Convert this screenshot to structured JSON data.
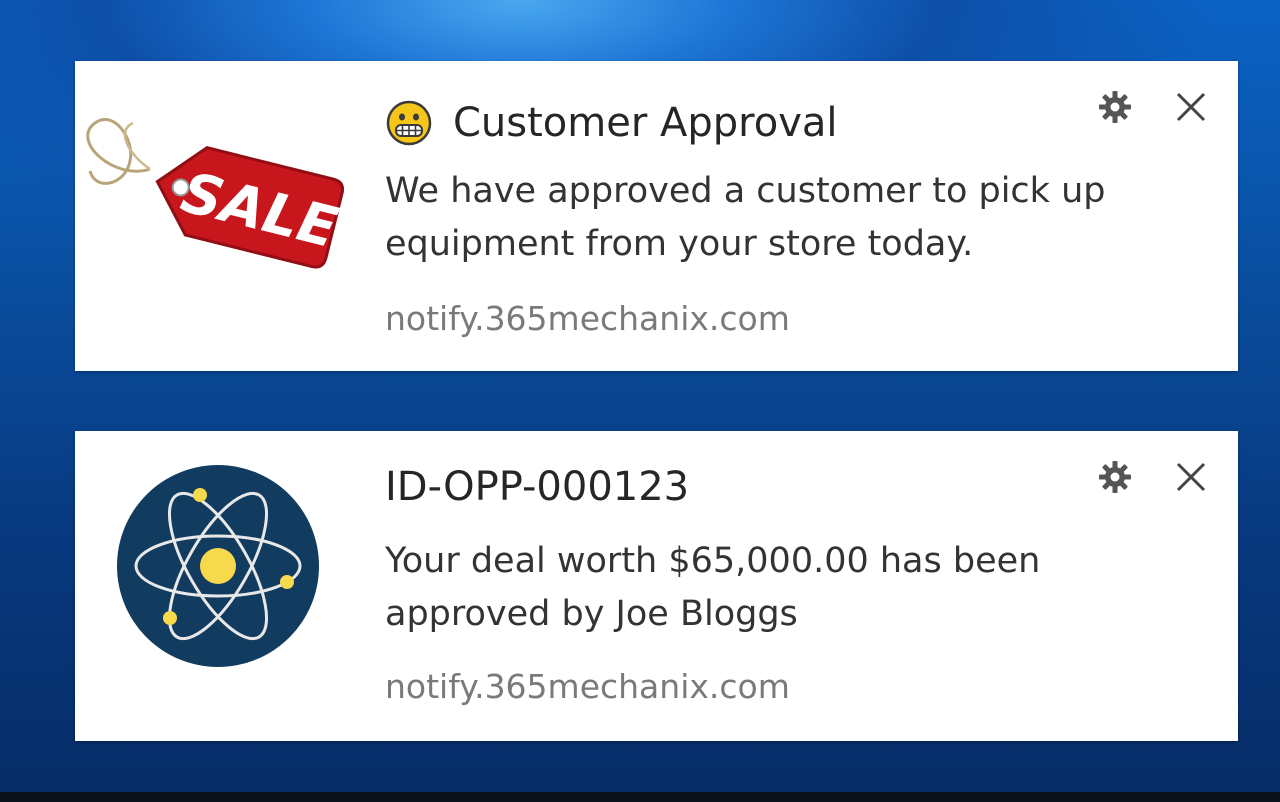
{
  "notifications": [
    {
      "image": "sale-tag-icon",
      "title_icon": "grimacing-face-emoji-icon",
      "title": "Customer Approval",
      "message": "We have approved a customer to pick up equipment from your store today.",
      "source": "notify.365mechanix.com",
      "image_text": "SALE"
    },
    {
      "image": "atom-logo-icon",
      "title": "ID-OPP-000123",
      "message": "Your deal worth $65,000.00 has been approved by Joe Bloggs",
      "source": "notify.365mechanix.com"
    }
  ],
  "colors": {
    "sale_tag_red": "#c8161d",
    "atom_circle": "#123b60",
    "atom_yellow": "#f7d94c",
    "emoji_yellow": "#f5c518",
    "desktop_blue": "#0a4e9f"
  },
  "icons": {
    "settings": "gear-icon",
    "dismiss": "close-icon"
  }
}
